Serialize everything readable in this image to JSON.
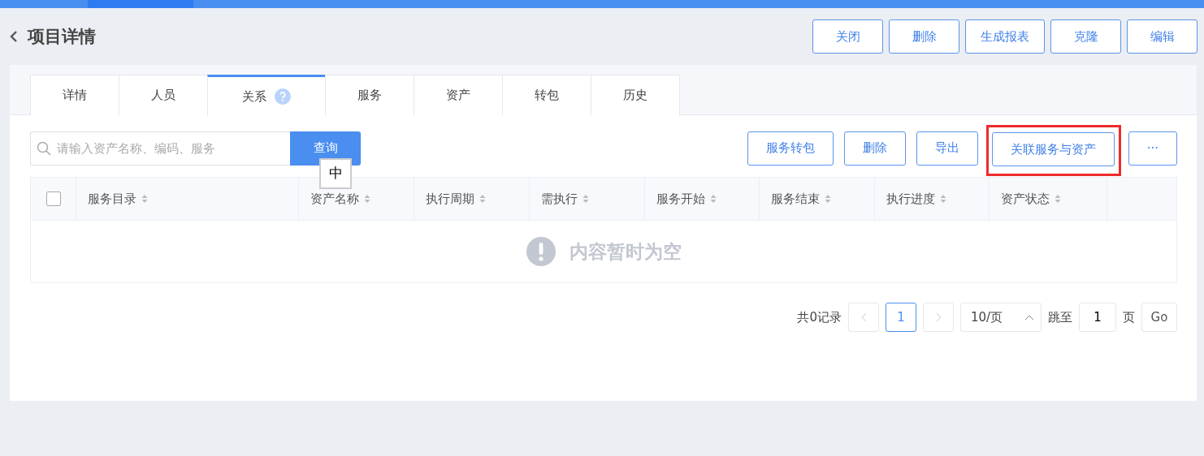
{
  "header": {
    "title": "项目详情",
    "actions": [
      {
        "label": "关闭"
      },
      {
        "label": "删除"
      },
      {
        "label": "生成报表"
      },
      {
        "label": "克隆"
      },
      {
        "label": "编辑"
      }
    ]
  },
  "tabs": [
    {
      "label": "详情",
      "selected": false,
      "help": false
    },
    {
      "label": "人员",
      "selected": false,
      "help": false
    },
    {
      "label": "关系",
      "selected": true,
      "help": true
    },
    {
      "label": "服务",
      "selected": false,
      "help": false
    },
    {
      "label": "资产",
      "selected": false,
      "help": false
    },
    {
      "label": "转包",
      "selected": false,
      "help": false
    },
    {
      "label": "历史",
      "selected": false,
      "help": false
    }
  ],
  "search": {
    "placeholder": "请输入资产名称、编码、服务",
    "button": "查询",
    "ime_indicator": "中"
  },
  "toolbar": [
    {
      "label": "服务转包",
      "highlighted": false
    },
    {
      "label": "删除",
      "highlighted": false
    },
    {
      "label": "导出",
      "highlighted": false
    },
    {
      "label": "关联服务与资产",
      "highlighted": true
    },
    {
      "label": "···",
      "highlighted": false
    }
  ],
  "table": {
    "select_all_checked": false,
    "columns": [
      "服务目录",
      "资产名称",
      "执行周期",
      "需执行",
      "服务开始",
      "服务结束",
      "执行进度",
      "资产状态"
    ],
    "empty_text": "内容暂时为空"
  },
  "pagination": {
    "total": "共0记录",
    "pages": [
      {
        "label": "1",
        "selected": true
      }
    ],
    "page_size": "10/页",
    "jump_label": "跳至",
    "jump_value": "1",
    "page_unit": "页",
    "go": "Go"
  }
}
